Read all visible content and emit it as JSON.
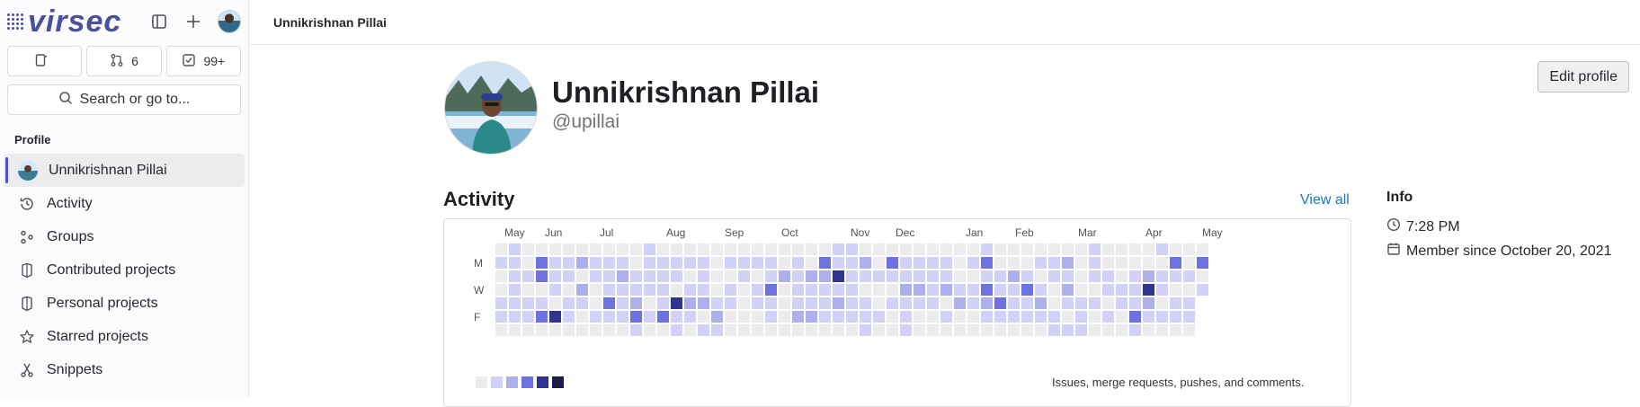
{
  "app": {
    "logo_text": "virsec"
  },
  "sidebar": {
    "counters": [
      {
        "icon": "issues-icon",
        "label": ""
      },
      {
        "icon": "merge-request-icon",
        "label": "6"
      },
      {
        "icon": "todo-icon",
        "label": "99+"
      }
    ],
    "search_label": "Search or go to...",
    "section_title": "Profile",
    "items": [
      {
        "label": "Unnikrishnan Pillai",
        "icon": "avatar",
        "active": true
      },
      {
        "label": "Activity",
        "icon": "history-icon"
      },
      {
        "label": "Groups",
        "icon": "groups-icon"
      },
      {
        "label": "Contributed projects",
        "icon": "project-icon"
      },
      {
        "label": "Personal projects",
        "icon": "project-icon"
      },
      {
        "label": "Starred projects",
        "icon": "star-icon"
      },
      {
        "label": "Snippets",
        "icon": "snippet-icon"
      }
    ]
  },
  "header": {
    "breadcrumb": "Unnikrishnan Pillai"
  },
  "profile": {
    "name": "Unnikrishnan Pillai",
    "handle": "@upillai",
    "edit_label": "Edit profile"
  },
  "activity": {
    "title": "Activity",
    "view_all": "View all",
    "months": [
      "May",
      "Jun",
      "Jul",
      "Aug",
      "Sep",
      "Oct",
      "Nov",
      "Dec",
      "Jan",
      "Feb",
      "Mar",
      "Apr",
      "May"
    ],
    "day_labels": [
      "M",
      "W",
      "F"
    ],
    "legend_text": "Issues, merge requests, pushes, and comments.",
    "colors": [
      "#ececef",
      "#d2d1f7",
      "#aeb0ee",
      "#6d72e0",
      "#303491",
      "#1b1c47"
    ]
  },
  "info": {
    "title": "Info",
    "time": "7:28 PM",
    "member_since": "Member since October 20, 2021"
  }
}
